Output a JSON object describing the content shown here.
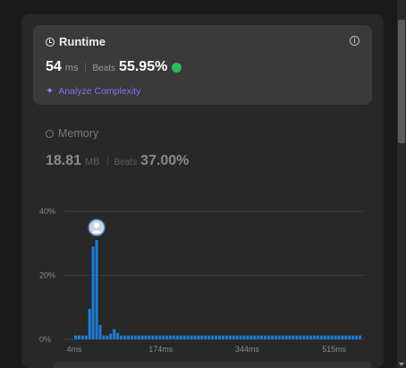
{
  "runtime": {
    "title": "Runtime",
    "value": "54",
    "unit": "ms",
    "beats_label": "Beats",
    "beats_value": "55.95%",
    "analyze_label": "Analyze Complexity",
    "icon": "clock-icon",
    "info_icon": "info-icon"
  },
  "memory": {
    "title": "Memory",
    "value": "18.81",
    "unit": "MB",
    "beats_label": "Beats",
    "beats_value": "37.00%",
    "icon": "memory-icon"
  },
  "colors": {
    "bar": "#1f7bd6",
    "accent_purple": "#8c6ef2",
    "green": "#2cbb5d"
  },
  "chart_data": {
    "type": "bar",
    "ylim": [
      0,
      40
    ],
    "y_ticks": [
      "0%",
      "20%",
      "40%"
    ],
    "x_ticks": [
      "4ms",
      "174ms",
      "344ms",
      "515ms"
    ],
    "x_tick_values": [
      4,
      174,
      344,
      515
    ],
    "x_range": [
      4,
      570
    ],
    "values": [
      1.2,
      1.2,
      1.2,
      1.2,
      9.5,
      29,
      31,
      4.5,
      1.2,
      1.2,
      1.8,
      3.2,
      2.0,
      1.2,
      1.2,
      1.2,
      1.2,
      1.2,
      1.2,
      1.2,
      1.2,
      1.2,
      1.2,
      1.2,
      1.2,
      1.2,
      1.2,
      1.2,
      1.2,
      1.2,
      1.2,
      1.2,
      1.2,
      1.2,
      1.2,
      1.2,
      1.2,
      1.2,
      1.2,
      1.2,
      1.2,
      1.2,
      1.2,
      1.2,
      1.2,
      1.2,
      1.2,
      1.2,
      1.2,
      1.2,
      1.2,
      1.2,
      1.2,
      1.2,
      1.2,
      1.2,
      1.2,
      1.2,
      1.2,
      1.2,
      1.2,
      1.2,
      1.2,
      1.2,
      1.2,
      1.2,
      1.2,
      1.2,
      1.2,
      1.2,
      1.2,
      1.2,
      1.2,
      1.2,
      1.2,
      1.2,
      1.2,
      1.2,
      1.2,
      1.2,
      1.2,
      1.2
    ],
    "highlight_index": 6,
    "grid": true
  }
}
